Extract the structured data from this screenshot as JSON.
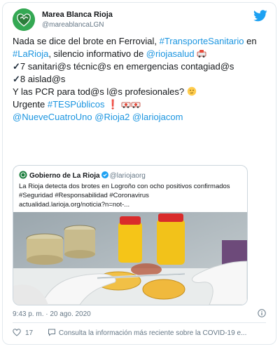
{
  "author": {
    "name": "Marea Blanca Rioja",
    "handle": "@mareablancaLGN"
  },
  "tweet": {
    "l1_text": "Nada se dice del brote en Ferrovial, ",
    "l1_tag": "#TransporteSanitario",
    "l1_tail": " en",
    "l2_tag": "#LaRioja",
    "l2_text": ", silencio informativo de ",
    "l2_mention": "@riojasalud",
    "l3_text": "7 sanitari@s técnic@s en emergencias contagiad@s",
    "l4_text": "8 aislad@s",
    "l5_text": "Y las PCR para tod@s l@s profesionales? ",
    "l6_text": "Urgente ",
    "l6_tag": "#TESPúblicos",
    "l7_m1": "@NueveCuatroUno",
    "l7_m2": "@Rioja2",
    "l7_m3": "@lariojacom"
  },
  "quoted": {
    "name": "Gobierno de La Rioja",
    "handle": "@lariojaorg",
    "line1": "La Rioja detecta dos brotes en Logroño con ocho positivos confirmados",
    "line2": "#Seguridad #Responsabilidad #Coronavirus",
    "line3": "actualidad.larioja.org/noticia?n=not-..."
  },
  "timestamp": "9:43 p. m. · 20 ago. 2020",
  "likes": "17",
  "footer_text": "Consulta la información más reciente sobre la COVID-19 e...",
  "colors": {
    "link": "#1b95e0",
    "text": "#14171a",
    "muted": "#657786",
    "border": "#e1e8ed"
  }
}
